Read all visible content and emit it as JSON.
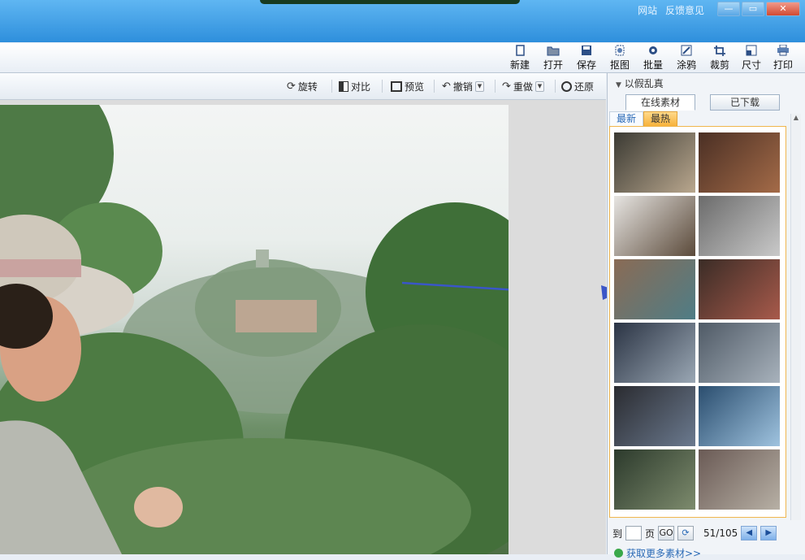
{
  "window": {
    "links": [
      "网站",
      "反馈意见"
    ],
    "controls": {
      "minimize": "—",
      "maximize": "▭",
      "close": "✕"
    }
  },
  "toolbar": {
    "items": [
      {
        "label": "新建",
        "icon": "new-file-icon"
      },
      {
        "label": "打开",
        "icon": "folder-open-icon"
      },
      {
        "label": "保存",
        "icon": "save-icon"
      },
      {
        "label": "抠图",
        "icon": "cutout-icon"
      },
      {
        "label": "批量",
        "icon": "batch-gear-icon"
      },
      {
        "label": "涂鸦",
        "icon": "doodle-icon"
      },
      {
        "label": "裁剪",
        "icon": "crop-icon"
      },
      {
        "label": "尺寸",
        "icon": "resize-icon"
      },
      {
        "label": "打印",
        "icon": "printer-icon"
      }
    ]
  },
  "edit_toolbar": {
    "rotate": "旋转",
    "compare": "对比",
    "preview": "预览",
    "undo": "撤销",
    "redo": "重做",
    "restore": "还原"
  },
  "panel": {
    "title": "以假乱真",
    "tabs": [
      "在线素材",
      "已下载"
    ],
    "active_tab": "在线素材",
    "subtabs": [
      "最新",
      "最热"
    ],
    "active_subtab": "最热",
    "thumbnail_count": 12,
    "pager": {
      "goto_label": "到",
      "page_label": "页",
      "go_label": "GO",
      "page_value": "51/105"
    },
    "more_link": "获取更多素材>>"
  },
  "colors": {
    "titlebar": "#2e8fdc",
    "accent_orange": "#f7b23b",
    "arrow": "#3a56c8",
    "link": "#2a6ab6"
  }
}
